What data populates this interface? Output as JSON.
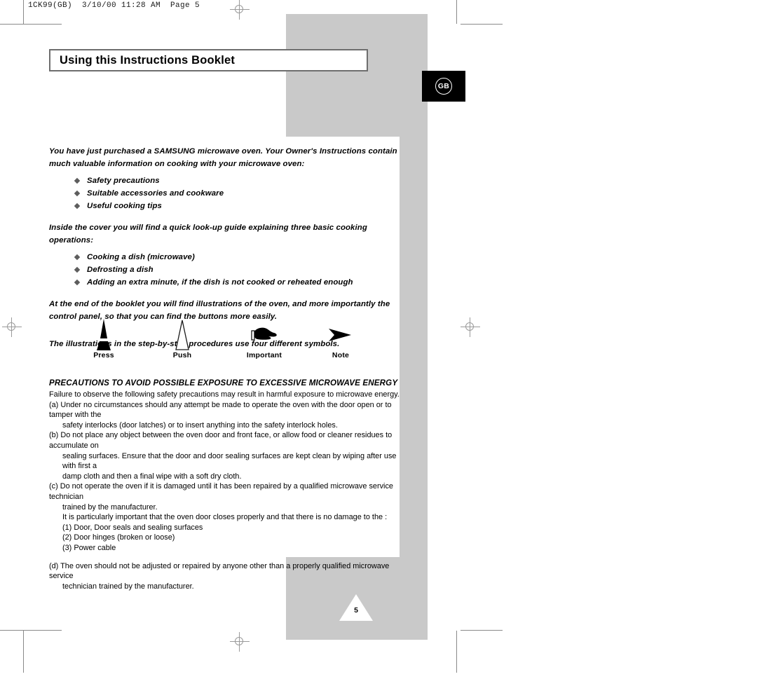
{
  "print_marks": {
    "slug": "1CK99(GB)  3/10/00 11:28 AM  Page 5"
  },
  "header": {
    "title": "Using this Instructions Booklet",
    "language_tab": "GB"
  },
  "intro": {
    "paragraph_1": "You have just purchased a SAMSUNG microwave oven. Your Owner's Instructions contain much valuable information on cooking with your microwave oven:",
    "list_1": [
      "Safety precautions",
      "Suitable accessories and cookware",
      "Useful cooking tips"
    ],
    "paragraph_2": "Inside the cover you will find a quick look-up guide explaining three basic cooking operations:",
    "list_2": [
      "Cooking a dish (microwave)",
      "Defrosting a dish",
      "Adding an extra minute, if the dish is not cooked or reheated enough"
    ],
    "paragraph_3": "At the end of the booklet you will find illustrations of the oven, and more importantly the control panel, so that you can find the buttons more easily.",
    "paragraph_4": "The illustrations in the step-by-step procedures use four different symbols."
  },
  "symbols": [
    {
      "icon": "press-triangle-icon",
      "label": "Press"
    },
    {
      "icon": "push-outline-triangle-icon",
      "label": "Push"
    },
    {
      "icon": "pointing-hand-icon",
      "label": "Important"
    },
    {
      "icon": "arrowhead-icon",
      "label": "Note"
    }
  ],
  "precautions": {
    "heading": "PRECAUTIONS TO AVOID POSSIBLE EXPOSURE TO EXCESSIVE MICROWAVE ENERGY",
    "intro": "Failure to observe the following safety precautions may result in harmful exposure to microwave energy.",
    "items": [
      {
        "lines": [
          "(a) Under no circumstances should any attempt be made to operate the oven with the door open or to tamper with the",
          "safety interlocks (door latches) or to insert anything into the safety interlock holes."
        ]
      },
      {
        "lines": [
          "(b) Do not place any object between the oven door and front face, or allow food or cleaner residues to accumulate on",
          "sealing surfaces. Ensure that the door and door sealing surfaces are kept clean by wiping after use with first a",
          "damp cloth and then a final wipe with a soft dry cloth."
        ]
      },
      {
        "lines": [
          "(c) Do not operate the oven if it is damaged until it has been repaired by a qualified microwave service technician",
          "trained by the manufacturer.",
          "It is particularly important that the oven door closes properly and that there is no damage to the :"
        ]
      }
    ],
    "sub_items": [
      "(1) Door, Door seals and sealing surfaces",
      "(2) Door hinges (broken or loose)",
      "(3) Power cable"
    ],
    "item_d": {
      "lines": [
        "(d) The oven should not be adjusted or repaired by anyone other than a properly qualified microwave service",
        "technician trained by the manufacturer."
      ]
    }
  },
  "footer": {
    "page_number": "5"
  },
  "colors": {
    "panel_grey": "#c9c9c9",
    "tab_black": "#000000",
    "mark_grey": "#8a8a8a",
    "border_grey": "#6e6e6e"
  }
}
